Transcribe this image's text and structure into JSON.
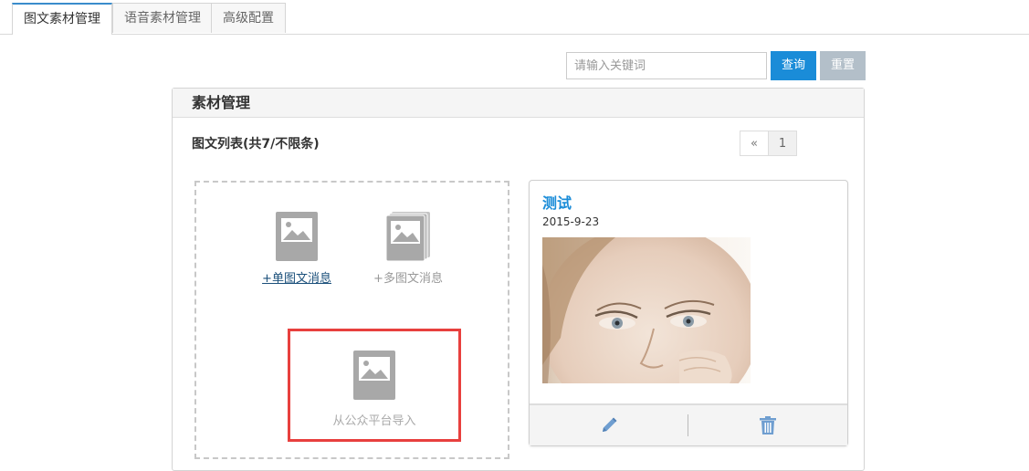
{
  "tabs": [
    {
      "label": "图文素材管理",
      "active": true
    },
    {
      "label": "语音素材管理",
      "active": false
    },
    {
      "label": "高级配置",
      "active": false
    }
  ],
  "search": {
    "placeholder": "请输入关键词",
    "value": "",
    "query_label": "查询",
    "reset_label": "重置"
  },
  "panel": {
    "title": "素材管理",
    "list_title": "图文列表(共7/不限条)",
    "pager": {
      "prev": "«",
      "page": "1"
    }
  },
  "add": {
    "single_label": "+单图文消息",
    "multi_label": "+多图文消息",
    "import_label": "从公众平台导入"
  },
  "article": {
    "title": "测试",
    "date": "2015-9-23",
    "image_icon": "face-photo",
    "actions": [
      "pencil-icon",
      "trash-icon"
    ]
  },
  "colors": {
    "accent": "#1a8cd8",
    "reset_button": "#b3bfc9",
    "highlight_border": "#e8403e",
    "icon_gray": "#a8a8a8"
  }
}
